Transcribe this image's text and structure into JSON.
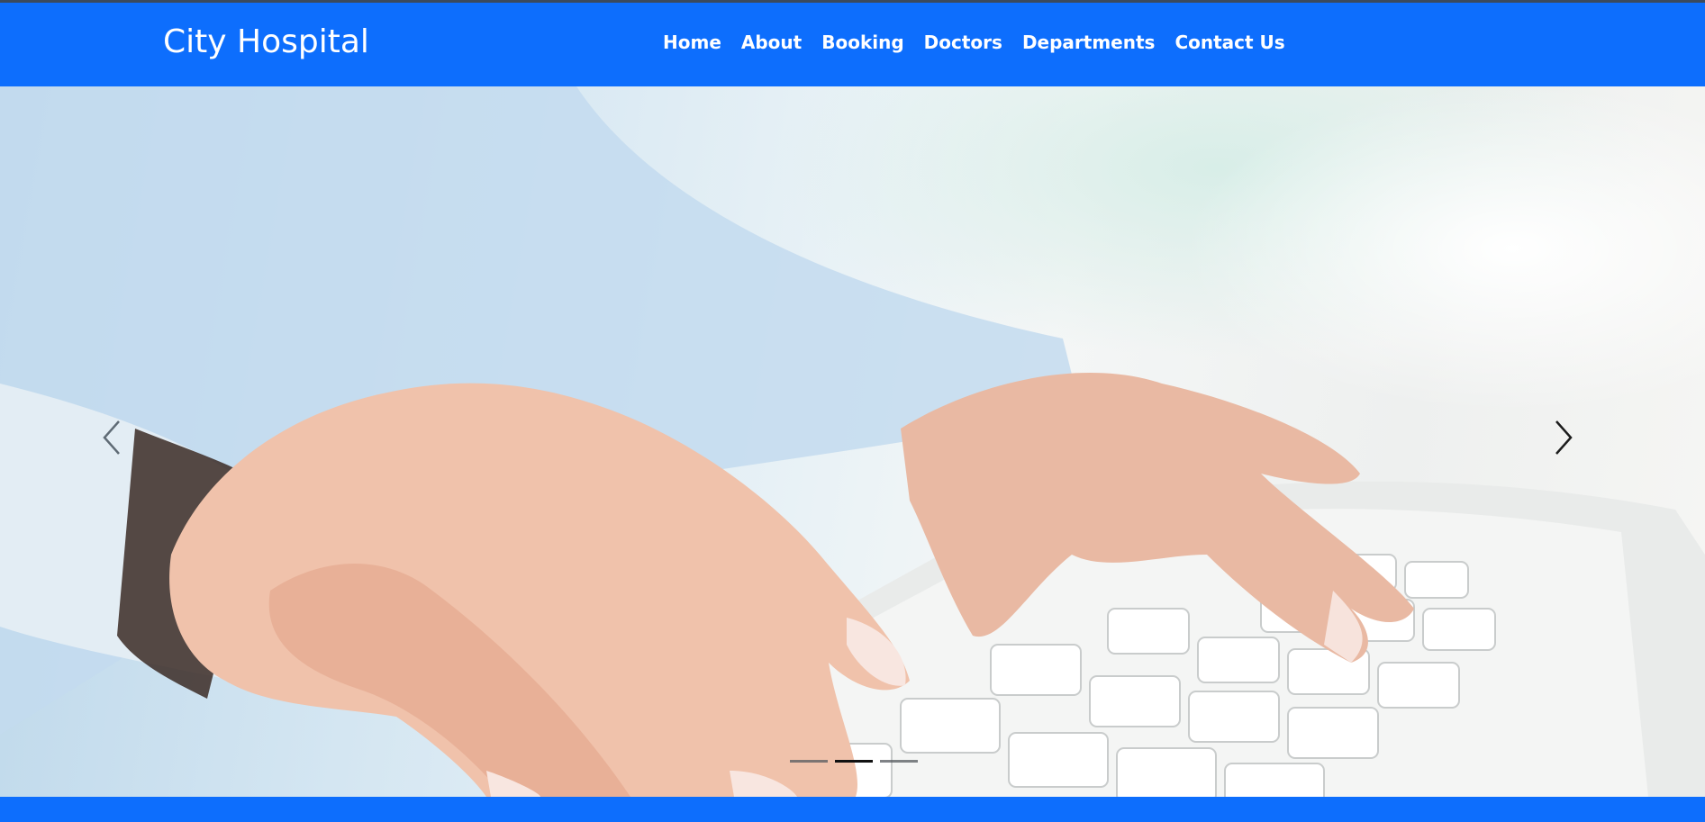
{
  "navbar": {
    "brand": "City Hospital",
    "links": [
      {
        "label": "Home"
      },
      {
        "label": "About"
      },
      {
        "label": "Booking"
      },
      {
        "label": "Doctors"
      },
      {
        "label": "Departments"
      },
      {
        "label": "Contact Us"
      }
    ]
  },
  "carousel": {
    "slide_image": "hands-typing-on-keyboard",
    "prev_icon": "chevron-left-icon",
    "next_icon": "chevron-right-icon",
    "slide_count": 3,
    "active_index": 1
  },
  "colors": {
    "primary": "#0d6efd",
    "nav_text": "#ffffff"
  }
}
